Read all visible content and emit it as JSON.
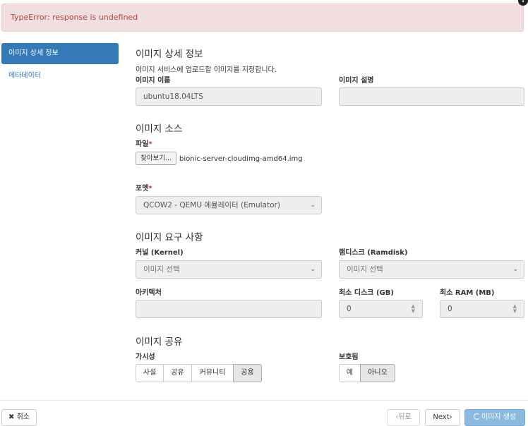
{
  "alert": {
    "text": "TypeError: response is undefined"
  },
  "sidebar": {
    "items": [
      {
        "label": "이미지 상세 정보",
        "active": true
      },
      {
        "label": "메타데이터",
        "active": false
      }
    ]
  },
  "details": {
    "title": "이미지 상세 정보",
    "help": "이미지 서비스에 업로드할 이미지를 지정합니다.",
    "name_label": "이미지 이름",
    "name_value": "ubuntu18.04LTS",
    "desc_label": "이미지 설명",
    "desc_value": ""
  },
  "source": {
    "title": "이미지 소스",
    "file_label": "파일",
    "browse_label": "찾아보기...",
    "file_name": "bionic-server-cloudimg-amd64.img",
    "format_label": "포멧",
    "format_value": "QCOW2 - QEMU 에뮬레이터 (Emulator)"
  },
  "requirements": {
    "title": "이미지 요구 사항",
    "kernel_label": "커널 (Kernel)",
    "kernel_value": "이미지 선택",
    "ramdisk_label": "램디스크 (Ramdisk)",
    "ramdisk_value": "이미지 선택",
    "arch_label": "아키텍처",
    "arch_value": "",
    "min_disk_label": "최소 디스크 (GB)",
    "min_disk_value": "0",
    "min_ram_label": "최소 RAM (MB)",
    "min_ram_value": "0"
  },
  "sharing": {
    "title": "이미지 공유",
    "visibility_label": "가시성",
    "visibility_options": [
      "사설",
      "공유",
      "커뮤니티",
      "공용"
    ],
    "visibility_selected": "공용",
    "protected_label": "보호됨",
    "protected_options": [
      "예",
      "아니오"
    ],
    "protected_selected": "아니오"
  },
  "footer": {
    "cancel_label": "취소",
    "back_label": "뒤로",
    "next_label": "Next",
    "create_label": "이미지 생성"
  },
  "colors": {
    "primary": "#337ab7",
    "alert_bg": "#f2dede",
    "alert_text": "#a94442"
  }
}
